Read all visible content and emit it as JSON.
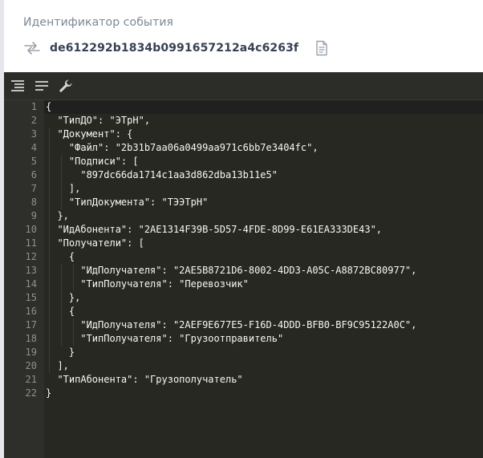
{
  "header": {
    "title": "Идентификатор события",
    "event_id": "de612292b1834b0991657212a4c6263f",
    "icons": [
      "exchange-icon",
      "copy-icon"
    ]
  },
  "toolbar": {
    "icons": [
      "format-icon",
      "compact-icon",
      "wrench-icon"
    ]
  },
  "editor": {
    "theme_colors": {
      "background": "#272822",
      "gutter": "#2e2e2b",
      "text": "#f8f8f2",
      "line_number": "#8f908a"
    },
    "line_numbers": [
      "1",
      "2",
      "3",
      "4",
      "5",
      "6",
      "7",
      "8",
      "9",
      "10",
      "11",
      "12",
      "13",
      "14",
      "15",
      "16",
      "17",
      "18",
      "19",
      "20",
      "21",
      "22"
    ],
    "lines": [
      "{",
      "  \"ТипДО\": \"ЭТрН\",",
      "  \"Документ\": {",
      "    \"Файл\": \"2b31b7aa06a0499aa971c6bb7e3404fc\",",
      "    \"Подписи\": [",
      "      \"897dc66da1714c1aa3d862dba13b11e5\"",
      "    ],",
      "    \"ТипДокумента\": \"ТЭЭТрН\"",
      "  },",
      "  \"ИдАбонента\": \"2AE1314F39B-5D57-4FDE-8D99-E61EA333DE43\",",
      "  \"Получатели\": [",
      "    {",
      "      \"ИдПолучателя\": \"2AE5B8721D6-8002-4DD3-A05C-A8872BC80977\",",
      "      \"ТипПолучателя\": \"Перевозчик\"",
      "    },",
      "    {",
      "      \"ИдПолучателя\": \"2AEF9E677E5-F16D-4DDD-BFB0-BF9C95122A0C\",",
      "      \"ТипПолучателя\": \"Грузоотправитель\"",
      "    }",
      "  ],",
      "  \"ТипАбонента\": \"Грузополучатель\"",
      "}"
    ]
  }
}
